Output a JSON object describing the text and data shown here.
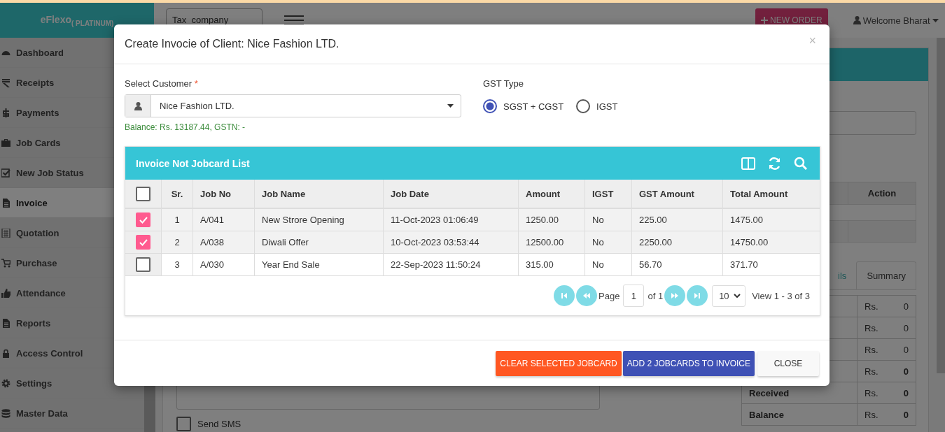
{
  "header": {
    "brand": "eFlexo",
    "edition": "( PLATINUM)",
    "company_select": "Tax_company",
    "new_order": "NEW ORDER",
    "welcome": "Welcome Bharat"
  },
  "sidebar": {
    "items": [
      {
        "label": "Dashboard",
        "selected": false
      },
      {
        "label": "Receipts",
        "selected": false
      },
      {
        "label": "Payments",
        "selected": false
      },
      {
        "label": "Job Cards",
        "selected": false
      },
      {
        "label": "New Job Status",
        "selected": false
      },
      {
        "label": "Invoice",
        "selected": true
      },
      {
        "label": "Quotation",
        "selected": false
      },
      {
        "label": "Purchase",
        "selected": false
      },
      {
        "label": "Attendance",
        "selected": false
      },
      {
        "label": "Reports",
        "selected": false
      },
      {
        "label": "Access Control",
        "selected": false
      },
      {
        "label": "Settings",
        "selected": false
      },
      {
        "label": "Master Data",
        "selected": false
      }
    ]
  },
  "page": {
    "action_header": "Action",
    "tabs": [
      {
        "label": "ils",
        "selected": false
      },
      {
        "label": "Summary",
        "selected": true
      }
    ],
    "summary_rows": [
      {
        "currency": "Rs.",
        "value": "0",
        "bold": false
      },
      {
        "currency": "Rs.",
        "value": "0",
        "bold": false
      },
      {
        "currency": "Rs.",
        "value": "0",
        "bold": false
      },
      {
        "currency": "Rs.",
        "value": "0",
        "bold": true
      },
      {
        "label": "Received",
        "currency": "Rs.",
        "value": "0",
        "bold": true
      },
      {
        "label": "Balance",
        "currency": "Rs.",
        "value": "0",
        "bold": true
      }
    ],
    "send_sms": {
      "label": "Send SMS",
      "checked": false
    }
  },
  "modal": {
    "title": "Create Invocie of Client: Nice Fashion LTD.",
    "close": "×",
    "customer": {
      "label": "Select Customer",
      "required_mark": "*",
      "value": "Nice Fashion LTD.",
      "balance": "Balance: Rs. 13187.44, GSTN: -"
    },
    "gst": {
      "label": "GST Type",
      "options": [
        {
          "label": "SGST + CGST",
          "selected": true
        },
        {
          "label": "IGST",
          "selected": false
        }
      ]
    },
    "grid": {
      "title": "Invoice Not Jobcard List",
      "all_checked": false,
      "columns": [
        "Sr.",
        "Job No",
        "Job Name",
        "Job Date",
        "Amount",
        "IGST",
        "GST Amount",
        "Total Amount"
      ],
      "rows": [
        {
          "selected": true,
          "cells": [
            "1",
            "A/041",
            "New Strore Opening",
            "11-Oct-2023 01:06:49",
            "1250.00",
            "No",
            "225.00",
            "1475.00"
          ]
        },
        {
          "selected": true,
          "cells": [
            "2",
            "A/038",
            "Diwali Offer",
            "10-Oct-2023 03:53:44",
            "12500.00",
            "No",
            "2250.00",
            "14750.00"
          ]
        },
        {
          "selected": false,
          "cells": [
            "3",
            "A/030",
            "Year End Sale",
            "22-Sep-2023 11:50:24",
            "315.00",
            "No",
            "56.70",
            "371.70"
          ]
        }
      ],
      "pager": {
        "page_label": "Page",
        "page": "1",
        "of": "of 1",
        "page_size": "10",
        "view": "View 1 - 3 of 3"
      }
    },
    "buttons": [
      {
        "label": "CLEAR SELECTED JOBCARD",
        "kind": "danger"
      },
      {
        "label": "ADD 2 JOBCARDS TO INVOICE",
        "kind": "primary"
      },
      {
        "label": "CLOSE",
        "kind": "default"
      }
    ]
  }
}
